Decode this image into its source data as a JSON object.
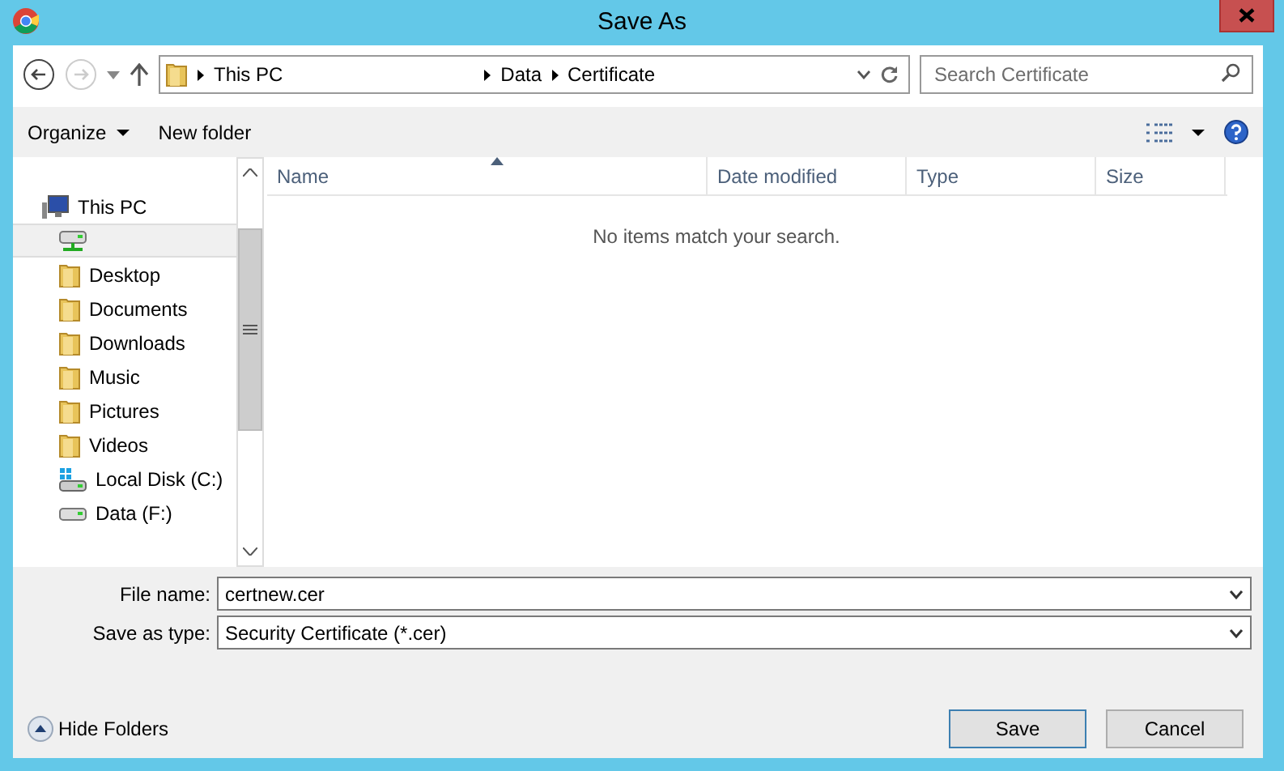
{
  "window": {
    "title": "Save As"
  },
  "address_bar": {
    "crumbs": [
      "This PC",
      "Data",
      "Certificate"
    ]
  },
  "search": {
    "placeholder": "Search Certificate"
  },
  "toolbar": {
    "buttons": [
      {
        "label": "Organize",
        "kind": "menu"
      },
      {
        "label": "New folder",
        "kind": "plain"
      }
    ]
  },
  "sidebar": {
    "items": [
      {
        "label": "This PC",
        "kind": "pc",
        "selected": false,
        "children": [
          {
            "kind": "network",
            "selected": true
          },
          {
            "label": "Desktop",
            "kind": "folder",
            "selected": false
          },
          {
            "label": "Documents",
            "kind": "folder",
            "selected": false
          },
          {
            "label": "Downloads",
            "kind": "folder",
            "selected": false
          },
          {
            "label": "Music",
            "kind": "folder",
            "selected": false
          },
          {
            "label": "Pictures",
            "kind": "folder",
            "selected": false
          },
          {
            "label": "Videos",
            "kind": "folder",
            "selected": false
          },
          {
            "label": "Local Disk (C:)",
            "kind": "system-drive",
            "selected": false
          },
          {
            "label": "Data (F:)",
            "kind": "drive",
            "selected": false
          }
        ]
      }
    ]
  },
  "file_list": {
    "columns": [
      {
        "label": "Name",
        "sorted": true
      },
      {
        "label": "Date modified",
        "sorted": false
      },
      {
        "label": "Type",
        "sorted": false
      },
      {
        "label": "Size",
        "sorted": false
      }
    ],
    "empty_message": "No items match your search."
  },
  "form": {
    "fields": [
      {
        "label": "File name:",
        "value": "certnew.cer"
      },
      {
        "label": "Save as type:",
        "value": "Security Certificate (*.cer)"
      }
    ]
  },
  "footer": {
    "toggle": "Hide Folders",
    "buttons": [
      {
        "label": "Save",
        "default": true
      },
      {
        "label": "Cancel",
        "default": false
      }
    ]
  }
}
